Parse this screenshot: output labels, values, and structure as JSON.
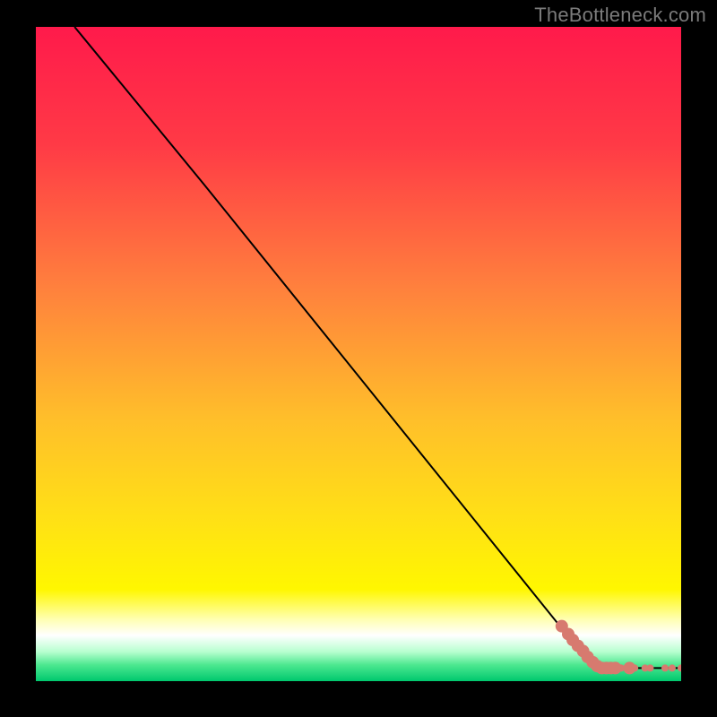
{
  "watermark": "TheBottleneck.com",
  "chart_data": {
    "type": "line",
    "title": "",
    "xlabel": "",
    "ylabel": "",
    "xlim": [
      0,
      100
    ],
    "ylim": [
      0,
      100
    ],
    "curve": {
      "x": [
        6,
        26,
        84,
        88,
        100
      ],
      "y": [
        100,
        76,
        5,
        2,
        2
      ],
      "color": "#000000"
    },
    "series": [
      {
        "name": "points",
        "color": "#d77a6f",
        "marker_radius_small": 4,
        "marker_radius_large": 7,
        "x": [
          81.5,
          82.5,
          83.2,
          84.0,
          84.8,
          85.5,
          86.3,
          87.0,
          87.7,
          88.4,
          89.1,
          89.8,
          90.7,
          92.0,
          92.8,
          94.4,
          95.2,
          97.5,
          98.6,
          100.0
        ],
        "y": [
          8.4,
          7.2,
          6.3,
          5.4,
          4.6,
          3.7,
          2.9,
          2.3,
          2.0,
          2.0,
          2.0,
          2.0,
          2.0,
          2.0,
          2.0,
          2.0,
          2.0,
          2.0,
          2.0,
          2.0
        ],
        "large_flags": [
          1,
          1,
          1,
          1,
          1,
          1,
          1,
          1,
          1,
          1,
          1,
          1,
          0,
          1,
          0,
          0,
          0,
          0,
          0,
          0
        ]
      }
    ],
    "gradient_stops": [
      {
        "offset": 0.0,
        "color": "#ff1a4b"
      },
      {
        "offset": 0.18,
        "color": "#ff3a46"
      },
      {
        "offset": 0.4,
        "color": "#ff813d"
      },
      {
        "offset": 0.6,
        "color": "#ffbf2a"
      },
      {
        "offset": 0.75,
        "color": "#ffe016"
      },
      {
        "offset": 0.86,
        "color": "#fff700"
      },
      {
        "offset": 0.905,
        "color": "#ffffb0"
      },
      {
        "offset": 0.93,
        "color": "#ffffff"
      },
      {
        "offset": 0.955,
        "color": "#b8ffd0"
      },
      {
        "offset": 0.975,
        "color": "#4de890"
      },
      {
        "offset": 1.0,
        "color": "#00c86e"
      }
    ]
  }
}
